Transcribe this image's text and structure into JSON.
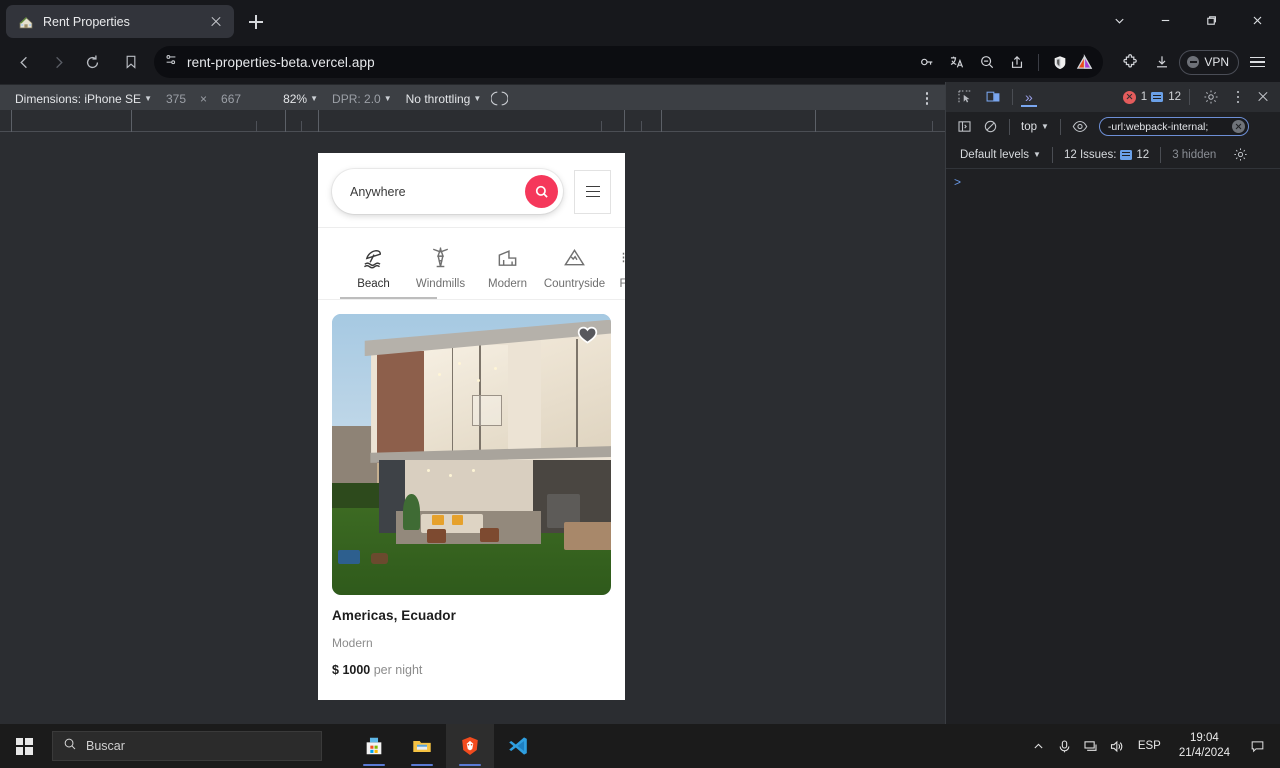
{
  "browser": {
    "tab": {
      "title": "Rent Properties",
      "favicon_icon": "house-favicon",
      "close_icon": "close-icon"
    },
    "newtab_icon": "plus-icon",
    "window_controls": {
      "chevron_icon": "chevron-down-icon",
      "minimize_icon": "minimize-icon",
      "maximize_icon": "restore-icon",
      "close_icon": "close-icon"
    },
    "nav": {
      "back_icon": "back-arrow-icon",
      "forward_icon": "forward-arrow-icon",
      "reload_icon": "reload-icon",
      "bookmark_icon": "bookmark-icon"
    },
    "url": "rent-properties-beta.vercel.app",
    "site_icon": "site-settings-icon",
    "url_actions": [
      "password-key-icon",
      "translate-icon",
      "zoom-out-icon",
      "share-icon",
      "brave-shields-icon",
      "brave-rewards-icon"
    ],
    "right_actions": [
      "extensions-puzzle-icon",
      "downloads-icon"
    ],
    "vpn_label": "VPN",
    "menu_icon": "hamburger-menu-icon"
  },
  "devtools": {
    "device_bar": {
      "dimensions_label": "Dimensions: iPhone SE",
      "width": "375",
      "times": "×",
      "height": "667",
      "zoom": "82%",
      "dpr": "DPR: 2.0",
      "throttling": "No throttling",
      "rotate_icon": "rotate-device-icon",
      "more_icon": "more-options-icon"
    },
    "panel": {
      "inspect_icon": "inspect-element-icon",
      "device_toolbar_icon": "device-toolbar-icon",
      "more_tabs_icon": "more-tabs-chevrons",
      "error_count": "1",
      "message_count": "12",
      "settings_icon": "settings-gear-icon",
      "kebab_icon": "more-options-icon",
      "close_icon": "close-devtools-icon"
    },
    "console": {
      "sidebar_icon": "console-sidebar-icon",
      "clear_icon": "clear-console-icon",
      "context": "top",
      "eye_icon": "live-expression-icon",
      "filter_value": "-url:webpack-internal;",
      "filter_clear_icon": "clear-filter-icon",
      "levels": "Default levels",
      "issues_label": "12 Issues:",
      "issues_count": "12",
      "hidden_label": "3 hidden",
      "settings_icon": "console-settings-icon",
      "prompt": ">"
    }
  },
  "app": {
    "search": {
      "value": "Anywhere",
      "placeholder": "Anywhere",
      "search_icon": "search-icon"
    },
    "menu_icon": "menu-icon",
    "categories": [
      {
        "label": "Beach",
        "icon": "beach-umbrella-icon",
        "active": true
      },
      {
        "label": "Windmills",
        "icon": "windmill-icon",
        "active": false
      },
      {
        "label": "Modern",
        "icon": "modern-building-icon",
        "active": false
      },
      {
        "label": "Countryside",
        "icon": "mountain-icon",
        "active": false
      },
      {
        "label": "F",
        "icon": "partial-icon",
        "active": false
      }
    ],
    "listing": {
      "title": "Americas, Ecuador",
      "category": "Modern",
      "currency": "$",
      "price": "1000",
      "price_unit": "per night",
      "favorite_icon": "heart-icon"
    },
    "accent_color": "#F5385B"
  },
  "taskbar": {
    "start_icon": "windows-start-icon",
    "search": {
      "placeholder": "Buscar",
      "icon": "search-icon"
    },
    "apps": [
      {
        "name": "microsoft-store",
        "active": false
      },
      {
        "name": "file-explorer",
        "active": false
      },
      {
        "name": "brave-browser",
        "active": true
      },
      {
        "name": "visual-studio-code",
        "active": false
      }
    ],
    "tray": {
      "overflow_icon": "show-hidden-icons-chevron",
      "mic_icon": "microphone-icon",
      "network_icon": "network-icon",
      "volume_icon": "volume-icon",
      "language": "ESP",
      "time": "19:04",
      "date": "21/4/2024",
      "notifications_icon": "notifications-icon"
    }
  }
}
